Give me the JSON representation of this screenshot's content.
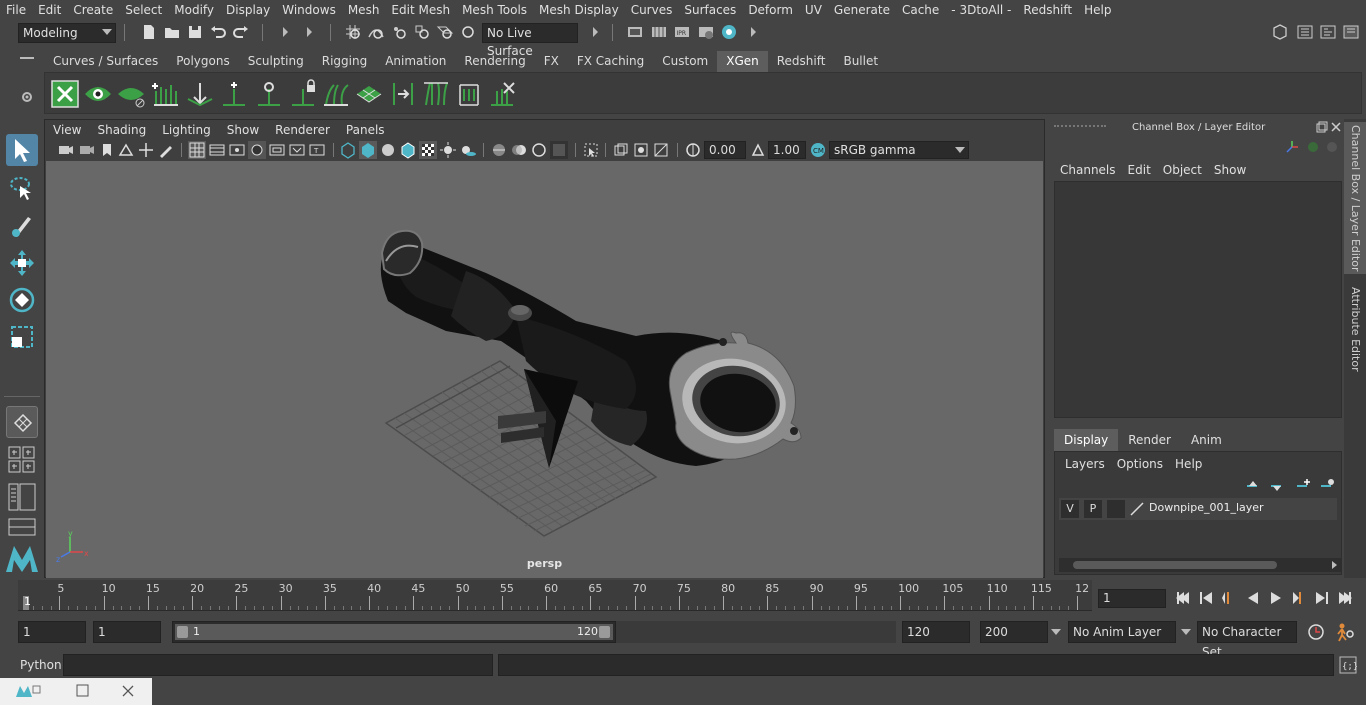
{
  "menubar": [
    "File",
    "Edit",
    "Create",
    "Select",
    "Modify",
    "Display",
    "Windows",
    "Mesh",
    "Edit Mesh",
    "Mesh Tools",
    "Mesh Display",
    "Curves",
    "Surfaces",
    "Deform",
    "UV",
    "Generate",
    "Cache",
    "- 3DtoAll -",
    "Redshift",
    "Help"
  ],
  "statusline": {
    "mode": "Modeling",
    "live_surface": "No Live Surface"
  },
  "shelf_tabs": [
    "Curves / Surfaces",
    "Polygons",
    "Sculpting",
    "Rigging",
    "Animation",
    "Rendering",
    "FX",
    "FX Caching",
    "Custom",
    "XGen",
    "Redshift",
    "Bullet"
  ],
  "shelf_active": "XGen",
  "viewport": {
    "menus": [
      "View",
      "Shading",
      "Lighting",
      "Show",
      "Renderer",
      "Panels"
    ],
    "exposure": "0.00",
    "gamma": "1.00",
    "color_space": "sRGB gamma",
    "camera_label": "persp"
  },
  "channel_box": {
    "title": "Channel Box / Layer Editor",
    "menus": [
      "Channels",
      "Edit",
      "Object",
      "Show"
    ],
    "layer_tabs": [
      "Display",
      "Render",
      "Anim"
    ],
    "layer_menus": [
      "Layers",
      "Options",
      "Help"
    ],
    "layer": {
      "v": "V",
      "p": "P",
      "name": "Downpipe_001_layer"
    }
  },
  "side_tabs": [
    "Channel Box / Layer Editor",
    "Attribute Editor"
  ],
  "timeline": {
    "start_label": "1",
    "ticks": [
      "5",
      "10",
      "15",
      "20",
      "25",
      "30",
      "35",
      "40",
      "45",
      "50",
      "55",
      "60",
      "65",
      "70",
      "75",
      "80",
      "85",
      "90",
      "95",
      "100",
      "105",
      "110",
      "115",
      "12"
    ],
    "current_frame": "1"
  },
  "range": {
    "start": "1",
    "playback_start": "1",
    "slider_start": "1",
    "slider_end": "120",
    "playback_end": "120",
    "end": "200",
    "anim_layer": "No Anim Layer",
    "character_set": "No Character Set"
  },
  "command": {
    "label": "Python"
  }
}
